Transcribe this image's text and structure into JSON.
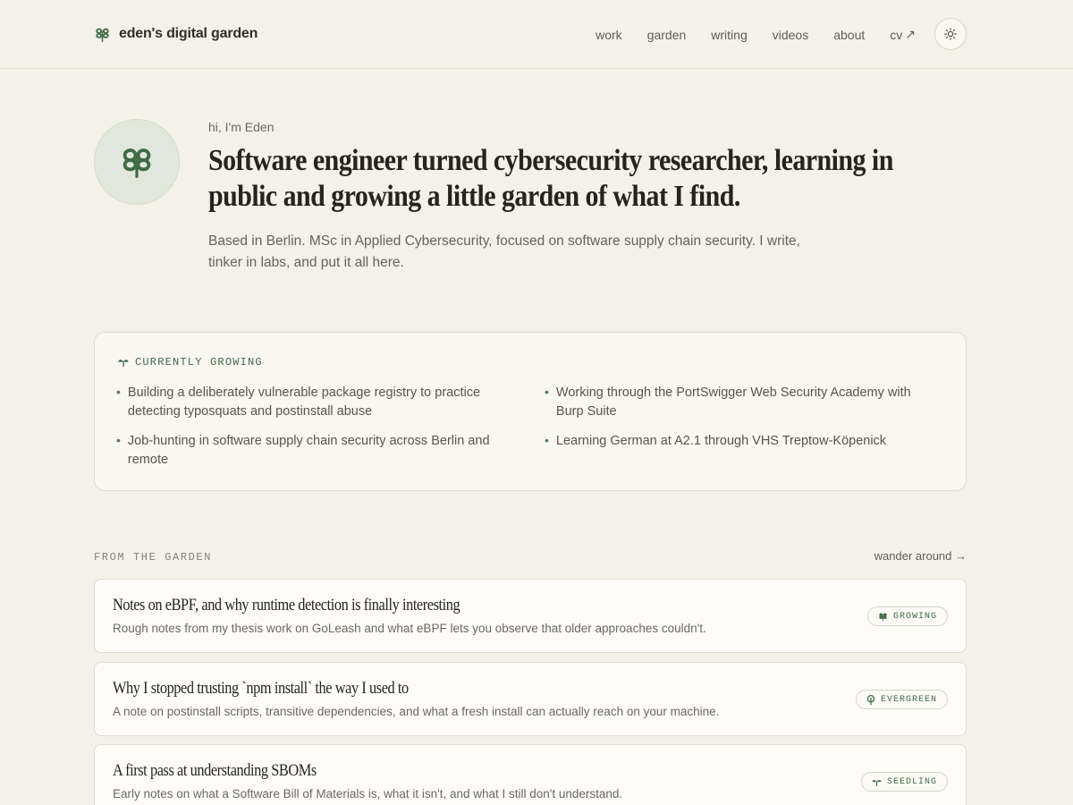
{
  "brand": {
    "name": "eden's digital garden",
    "icon": "clover-icon"
  },
  "nav": {
    "items": [
      {
        "label": "work"
      },
      {
        "label": "garden"
      },
      {
        "label": "writing"
      },
      {
        "label": "videos"
      },
      {
        "label": "about"
      },
      {
        "label": "cv",
        "arrow": "↗"
      }
    ],
    "theme_icon": "sun-icon"
  },
  "hero": {
    "greeting": "hi, I'm Eden",
    "title": "Software engineer turned cybersecurity researcher, learning in public and growing a little garden of what I find.",
    "subtitle": "Based in Berlin. MSc in Applied Cybersecurity, focused on software supply chain security. I write, tinker in labs, and put it all here."
  },
  "growing": {
    "label": "CURRENTLY GROWING",
    "items": [
      "Building a deliberately vulnerable package registry to practice detecting typosquats and postinstall abuse",
      "Working through the PortSwigger Web Security Academy with Burp Suite",
      "Job-hunting in software supply chain security across Berlin and remote",
      "Learning German at A2.1 through VHS Treptow-Köpenick"
    ]
  },
  "garden": {
    "section_title": "FROM THE GARDEN",
    "wander_label": "wander around →",
    "posts": [
      {
        "title": "Notes on eBPF, and why runtime detection is finally interesting",
        "description": "Rough notes from my thesis work on GoLeash and what eBPF lets you observe that older approaches couldn't.",
        "badge": "GROWING"
      },
      {
        "title": "Why I stopped trusting `npm install` the way I used to",
        "description": "A note on postinstall scripts, transitive dependencies, and what a fresh install can actually reach on your machine.",
        "badge": "EVERGREEN"
      },
      {
        "title": "A first pass at understanding SBOMs",
        "description": "Early notes on what a Software Bill of Materials is, what it isn't, and what I still don't understand.",
        "badge": "SEEDLING"
      }
    ]
  },
  "colors": {
    "background": "#f4f0ea",
    "accent": "#3f6b45",
    "card": "#f9f7f2"
  }
}
